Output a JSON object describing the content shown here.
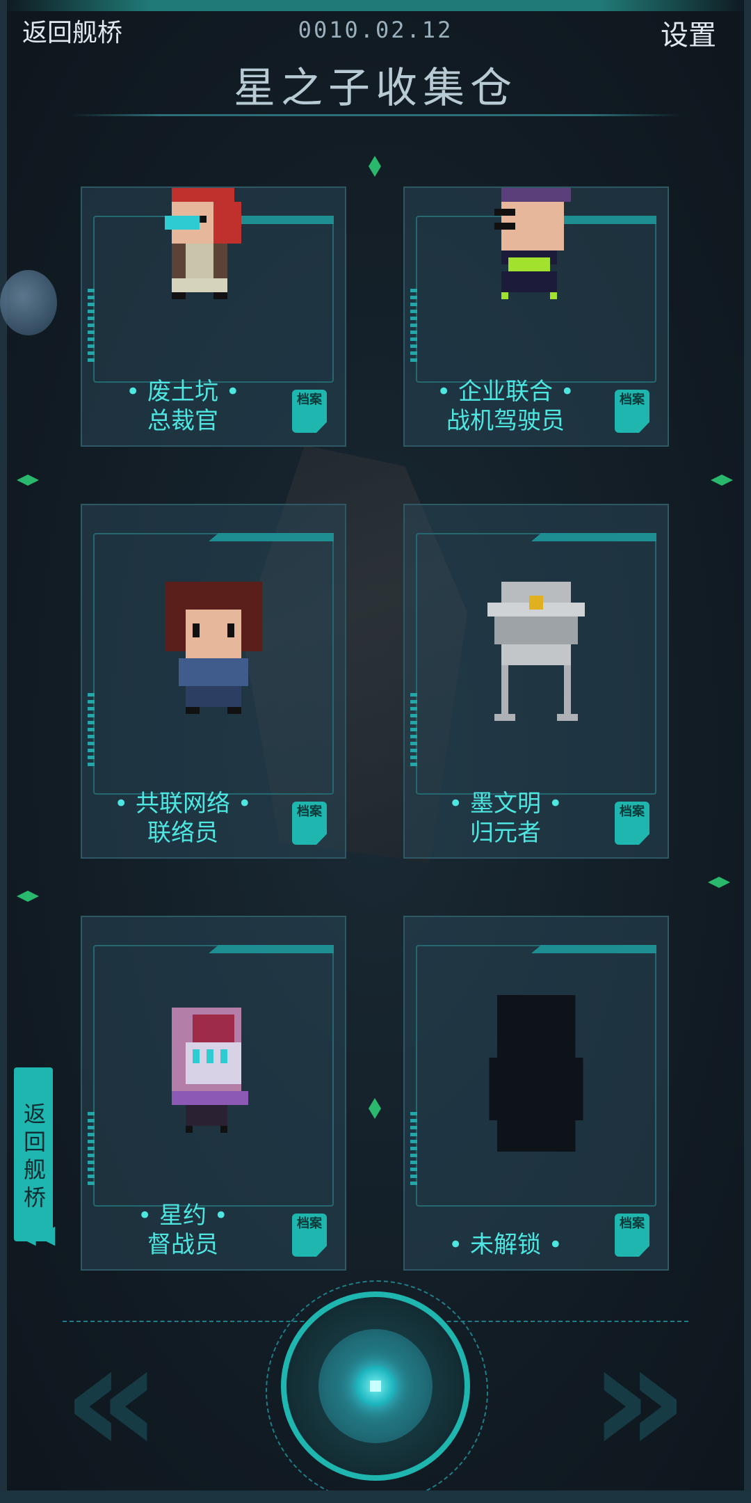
{
  "topbar": {
    "back_label": "返回舰桥",
    "date": "0010.02.12",
    "settings_label": "设置"
  },
  "page_title": "星之子收集仓",
  "cards": [
    {
      "name_line1": "• 废土坑 •",
      "name_line2": "总裁官",
      "archive_label": "档案",
      "status": "unlocked"
    },
    {
      "name_line1": "• 企业联合 •",
      "name_line2": "战机驾驶员",
      "archive_label": "档案",
      "status": "unlocked"
    },
    {
      "name_line1": "• 共联网络 •",
      "name_line2": "联络员",
      "archive_label": "档案",
      "status": "unlocked"
    },
    {
      "name_line1": "• 墨文明 •",
      "name_line2": "归元者",
      "archive_label": "档案",
      "status": "unlocked"
    },
    {
      "name_line1": "• 星约 •",
      "name_line2": "督战员",
      "archive_label": "档案",
      "status": "unlocked"
    },
    {
      "name_line1": "• 未解锁 •",
      "name_line2": "",
      "archive_label": "档案",
      "status": "locked"
    }
  ],
  "side_tab": {
    "label": "返回舰桥",
    "arrow_icon": "double-chevron-left-icon"
  },
  "nav": {
    "prev_icon": "double-chevron-left-icon",
    "next_icon": "double-chevron-right-icon",
    "center_icon": "scanner-button-icon"
  },
  "colors": {
    "accent": "#1fb6b0",
    "text_cyan": "#4ee6e0",
    "background": "#14202a"
  }
}
